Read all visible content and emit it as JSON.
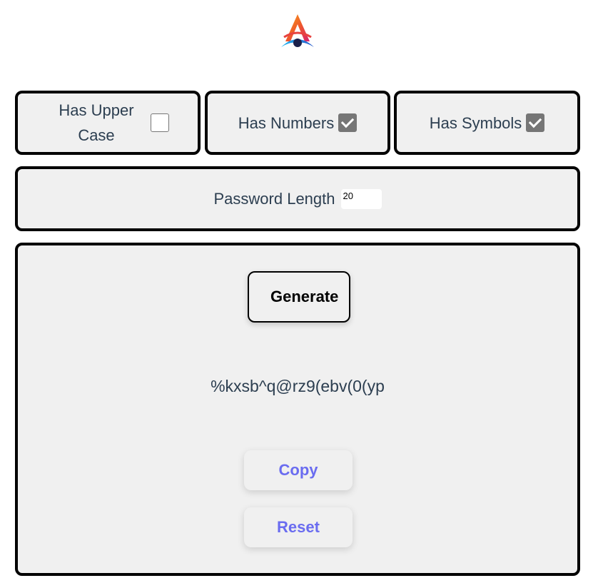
{
  "logo": {
    "icon": "app-logo-icon"
  },
  "options": {
    "upper": {
      "label": "Has Upper Case",
      "checked": false
    },
    "numbers": {
      "label": "Has Numbers",
      "checked": true
    },
    "symbols": {
      "label": "Has Symbols",
      "checked": true
    }
  },
  "length": {
    "label": "Password Length",
    "value": "20"
  },
  "actions": {
    "generate_label": "Generate",
    "copy_label": "Copy",
    "reset_label": "Reset"
  },
  "output": {
    "password": "%kxsb^q@rz9(ebv(0(yp"
  },
  "colors": {
    "border": "#000000",
    "panel": "#f0f0f0",
    "text": "#2c3e50",
    "accent": "#6a6cf0"
  }
}
